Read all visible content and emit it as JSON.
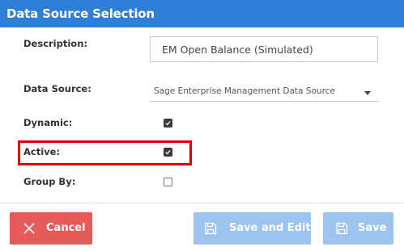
{
  "dialog": {
    "title": "Data Source Selection"
  },
  "fields": {
    "description": {
      "label": "Description:",
      "value": "EM Open Balance (Simulated)"
    },
    "data_source": {
      "label": "Data Source:",
      "selected": "Sage Enterprise Management Data Source"
    },
    "dynamic": {
      "label": "Dynamic:",
      "checked": true
    },
    "active": {
      "label": "Active:",
      "checked": true
    },
    "group_by": {
      "label": "Group By:",
      "checked": false
    }
  },
  "buttons": {
    "cancel": "Cancel",
    "save_and_edit": "Save and Edit",
    "save": "Save"
  },
  "colors": {
    "titlebar": "#2f7ed8",
    "cancel_button": "#e75a5a",
    "save_button_disabled": "#9cc4ee",
    "highlight_border": "#e00000"
  },
  "icons": {
    "cancel": "close-icon",
    "save_and_edit": "save-icon",
    "save": "save-icon",
    "select": "caret-down-icon",
    "checkbox": "checkmark-icon"
  }
}
